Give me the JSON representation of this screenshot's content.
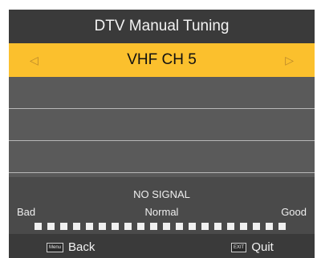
{
  "header": {
    "title": "DTV Manual Tuning"
  },
  "channel": {
    "value": "VHF  CH 5",
    "left_arrow": "◁",
    "right_arrow": "▷"
  },
  "signal": {
    "status": "NO SIGNAL",
    "bad_label": "Bad",
    "normal_label": "Normal",
    "good_label": "Good",
    "level_fraction": 0,
    "segment_count": 20
  },
  "footer": {
    "back_icon_text": "Menu",
    "back_label": "Back",
    "quit_icon_text": "EXIT",
    "quit_label": "Quit"
  },
  "colors": {
    "highlight": "#fbc02d",
    "panel": "#585858",
    "bar": "#3a3a3a"
  }
}
